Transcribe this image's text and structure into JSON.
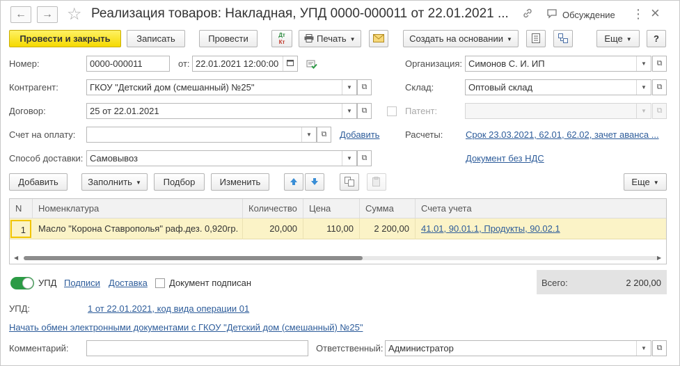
{
  "header": {
    "back_glyph": "←",
    "forward_glyph": "→",
    "star_glyph": "☆",
    "title": "Реализация товаров: Накладная, УПД 0000-000011 от 22.01.2021 ...",
    "discuss_label": "Обсуждение",
    "more_glyph": "⋮",
    "close_glyph": "×",
    "link_glyph": "🔗"
  },
  "toolbar": {
    "post_close_label": "Провести и закрыть",
    "save_label": "Записать",
    "post_label": "Провести",
    "dtkt_top": "Дт",
    "dtkt_bottom": "Кт",
    "print_label": "Печать",
    "create_based_label": "Создать на основании",
    "more_label": "Еще",
    "help_label": "?"
  },
  "form": {
    "number_label": "Номер:",
    "number_value": "0000-000011",
    "from_label": "от:",
    "date_value": "22.01.2021 12:00:00",
    "org_label": "Организация:",
    "org_value": "Симонов С. И. ИП",
    "contractor_label": "Контрагент:",
    "contractor_value": "ГКОУ \"Детский дом (смешанный) №25\"",
    "warehouse_label": "Склад:",
    "warehouse_value": "Оптовый склад",
    "contract_label": "Договор:",
    "contract_value": "25 от 22.01.2021",
    "patent_label": "Патент:",
    "patent_value": "",
    "invoice_label": "Счет на оплату:",
    "invoice_value": "",
    "add_link": "Добавить",
    "settlements_label": "Расчеты:",
    "settlements_link": "Срок 23.03.2021, 62.01, 62.02, зачет аванса ...",
    "delivery_label": "Способ доставки:",
    "delivery_value": "Самовывоз",
    "no_vat_link": "Документ без НДС"
  },
  "table_toolbar": {
    "add_label": "Добавить",
    "fill_label": "Заполнить",
    "pick_label": "Подбор",
    "change_label": "Изменить",
    "more_label": "Еще"
  },
  "table": {
    "columns": [
      "N",
      "Номенклатура",
      "Количество",
      "Цена",
      "Сумма",
      "Счета учета"
    ],
    "rows": [
      {
        "n": "1",
        "name": "Масло \"Корона Ставрополья\" раф.дез. 0,920гр.",
        "qty": "20,000",
        "price": "110,00",
        "sum": "2 200,00",
        "accounts": "41.01, 90.01.1, Продукты, 90.02.1"
      }
    ]
  },
  "footer": {
    "upd_toggle_label": "УПД",
    "signatures_link": "Подписи",
    "delivery_link": "Доставка",
    "signed_label": "Документ подписан",
    "total_label": "Всего:",
    "total_value": "2 200,00",
    "upd_label": "УПД:",
    "upd_link": "1 от 22.01.2021, код вида операции 01",
    "edo_link": "Начать обмен электронными документами с ГКОУ \"Детский дом (смешанный) №25\"",
    "comment_label": "Комментарий:",
    "comment_value": "",
    "responsible_label": "Ответственный:",
    "responsible_value": "Администратор"
  },
  "colors": {
    "primary_button": "#f5d900",
    "link": "#2d5c9a",
    "selected_row": "#fbf3c7",
    "toggle_on": "#2b9b45"
  }
}
